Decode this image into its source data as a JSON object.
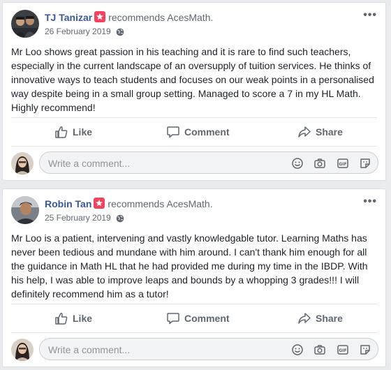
{
  "posts": [
    {
      "author": "TJ Tanizar",
      "recommends": "recommends AcesMath.",
      "date": "26 February 2019",
      "text": "Mr Loo shows great passion in his teaching and it is rare to find such teachers, especially in the current landscape of an oversupply of tuition services. He thinks of innovative ways to teach students and focuses on our weak points in a personalised way despite being in a small group setting. Managed to score a 7 in my HL Math. Highly recommend!",
      "avatar_icon": "profile-photo"
    },
    {
      "author": "Robin Tan",
      "recommends": "recommends AcesMath.",
      "date": "25 February 2019",
      "text": "Mr Loo is a patient, intervening and vastly knowledgable tutor. Learning Maths has never been tedious and mundane with him around. I can't thank him enough for all the guidance in Math HL that he had provided me during my time in the IBDP. With his help, I was able to improve leaps and bounds by a whopping 3 grades!!! I will definitely recommend him as a tutor!",
      "avatar_icon": "profile-photo"
    }
  ],
  "actions": {
    "like": "Like",
    "comment": "Comment",
    "share": "Share"
  },
  "comment_box": {
    "placeholder": "Write a comment..."
  },
  "icons": [
    "more-options-icon",
    "globe-icon",
    "recommend-badge-icon",
    "like-icon",
    "comment-icon",
    "share-icon",
    "emoji-icon",
    "camera-icon",
    "gif-icon",
    "sticker-icon"
  ],
  "colors": {
    "name": "#385898",
    "badge": "#f3425f",
    "muted": "#606770",
    "background": "#e9ebee"
  }
}
